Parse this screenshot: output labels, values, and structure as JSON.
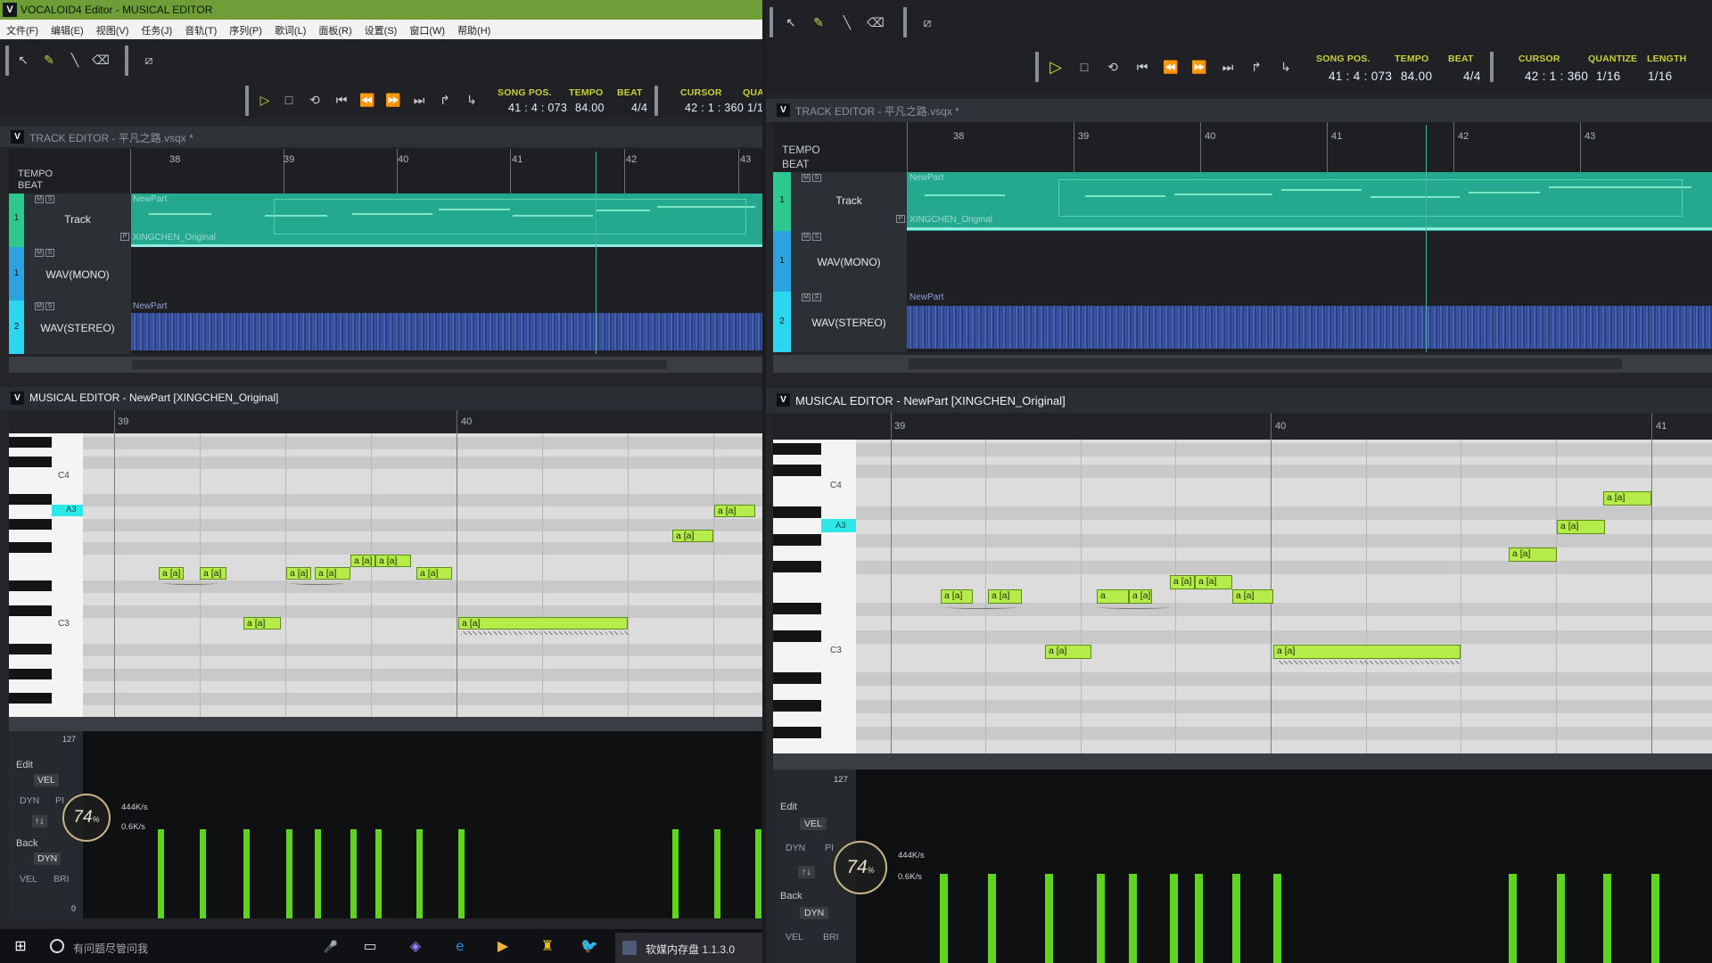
{
  "window": {
    "title": "VOCALOID4 Editor - MUSICAL EDITOR",
    "app_icon": "V"
  },
  "menu": [
    "文件(F)",
    "编辑(E)",
    "视图(V)",
    "任务(J)",
    "音轨(T)",
    "序列(P)",
    "歌词(L)",
    "面板(R)",
    "设置(S)",
    "窗口(W)",
    "帮助(H)"
  ],
  "transport": {
    "song_pos_label": "SONG POS.",
    "song_pos": "41 : 4 : 073",
    "tempo_label": "TEMPO",
    "tempo": "84.00",
    "beat_label": "BEAT",
    "beat": "4/4",
    "cursor_label": "CURSOR",
    "cursor": "42 : 1 : 360",
    "quantize_label": "QUANTIZE",
    "quantize": "1/16",
    "length_label": "LENGTH",
    "length": "1/16",
    "quantize_short": "QUA",
    "value_short": "1/1"
  },
  "track_editor": {
    "title": "TRACK EDITOR - 平凡之路.vsqx *",
    "tempo_label": "TEMPO",
    "beat_label": "BEAT",
    "bars": [
      "38",
      "39",
      "40",
      "41",
      "42",
      "43"
    ],
    "tracks": [
      {
        "num": "1",
        "name": "Track",
        "part_name": "NewPart",
        "part_singer": "XINGCHEN_Original",
        "color": "#2cc890"
      },
      {
        "num": "1",
        "name": "WAV(MONO)",
        "color": "#2aa3e0"
      },
      {
        "num": "2",
        "name": "WAV(STEREO)",
        "part_name": "NewPart",
        "color": "#2ad6f0"
      }
    ],
    "ms_labels": [
      "M",
      "S"
    ],
    "p_label": "P"
  },
  "musical_editor": {
    "title": "MUSICAL EDITOR - NewPart [XINGCHEN_Original]",
    "bars_left": [
      "39",
      "40"
    ],
    "bars_right": [
      "39",
      "40",
      "41"
    ],
    "key_labels": [
      "C4",
      "A3",
      "C3"
    ],
    "notes_left": [
      "a [a]",
      "a [a]",
      "a [a]",
      "a [a]",
      "a [a]",
      "a [a]",
      "a [a]",
      "a [a]",
      "a [a]",
      "a [a]",
      "a [a]"
    ],
    "notes_right": [
      "a [a]",
      "a [a]",
      "a [a]",
      "a",
      "a [a]",
      "a [a]",
      "a [a]",
      "a [a]",
      "a [a]",
      "a [a]",
      "a [a]",
      "a [a]"
    ]
  },
  "control": {
    "max": "127",
    "min": "0",
    "edit_label": "Edit",
    "edit_value": "VEL",
    "dyn": "DYN",
    "pit": "PI",
    "back_label": "Back",
    "back_value": "DYN",
    "vel": "VEL",
    "bri": "BRI",
    "arrows": "↑↓"
  },
  "overlay": {
    "cpu_percent": "74",
    "percent_sign": "%",
    "up_speed": "444K/s",
    "down_speed": "0.6K/s"
  },
  "taskbar": {
    "search_placeholder": "有问题尽管问我",
    "app_label": "软媒内存盘 1.1.3.0"
  }
}
